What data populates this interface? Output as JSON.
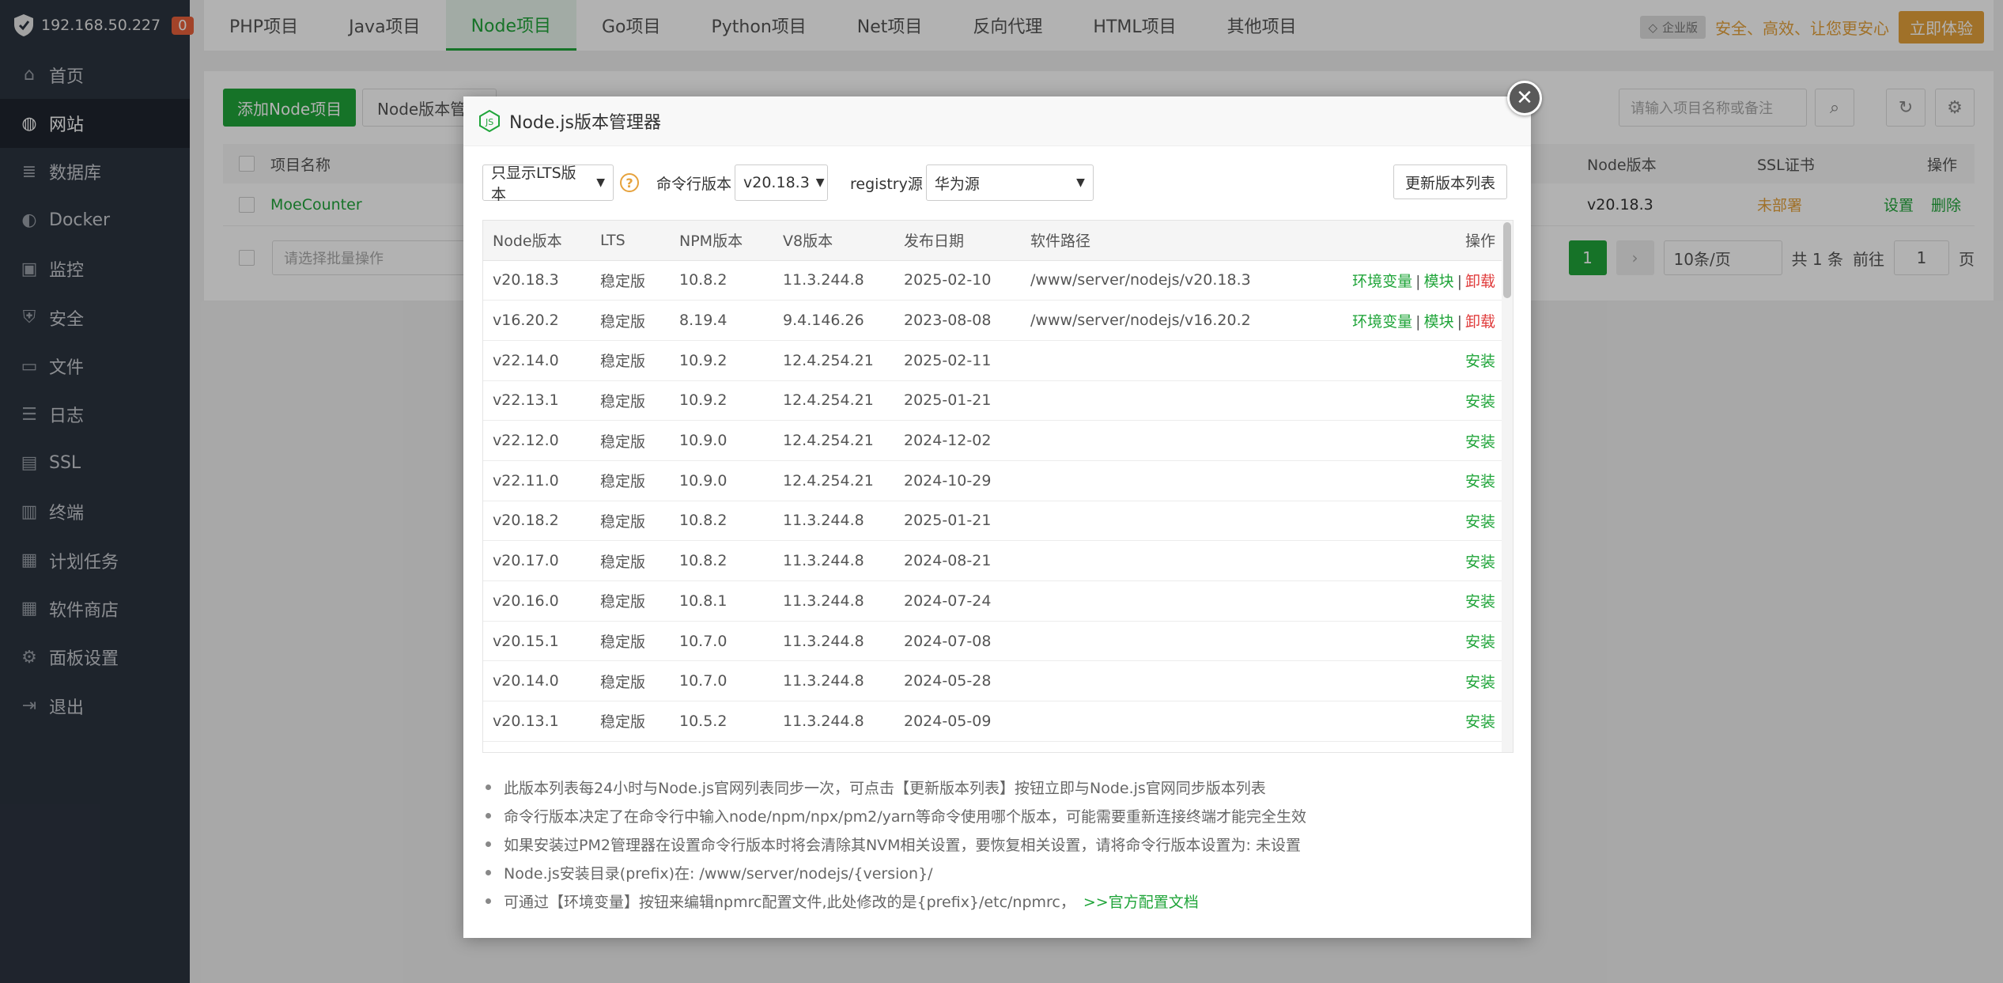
{
  "sidebar": {
    "host": "192.168.50.227",
    "badge": "0",
    "items": [
      {
        "label": "首页",
        "icon": "home-icon"
      },
      {
        "label": "网站",
        "icon": "globe-icon",
        "active": true
      },
      {
        "label": "数据库",
        "icon": "database-icon"
      },
      {
        "label": "Docker",
        "icon": "docker-icon"
      },
      {
        "label": "监控",
        "icon": "monitor-icon"
      },
      {
        "label": "安全",
        "icon": "shield-icon"
      },
      {
        "label": "文件",
        "icon": "folder-icon"
      },
      {
        "label": "日志",
        "icon": "log-icon"
      },
      {
        "label": "SSL",
        "icon": "ssl-icon"
      },
      {
        "label": "终端",
        "icon": "terminal-icon"
      },
      {
        "label": "计划任务",
        "icon": "calendar-icon"
      },
      {
        "label": "软件商店",
        "icon": "grid-icon"
      },
      {
        "label": "面板设置",
        "icon": "gear-icon"
      },
      {
        "label": "退出",
        "icon": "logout-icon"
      }
    ]
  },
  "topbar": {
    "tabs": [
      "PHP项目",
      "Java项目",
      "Node项目",
      "Go项目",
      "Python项目",
      "Net项目",
      "反向代理",
      "HTML项目",
      "其他项目"
    ],
    "active_tab": "Node项目",
    "enterprise_tag": "企业版",
    "slogan": "安全、高效、让您更安心",
    "try_button": "立即体验"
  },
  "page": {
    "add_button": "添加Node项目",
    "version_button": "Node版本管理",
    "search_placeholder": "请输入项目名称或备注",
    "table_headers": {
      "name": "项目名称",
      "node_version": "Node版本",
      "ssl": "SSL证书",
      "ops": "操作"
    },
    "row": {
      "name": "MoeCounter",
      "node_version": "v20.18.3",
      "ssl": "未部署",
      "settings": "设置",
      "delete": "删除"
    },
    "batch_placeholder": "请选择批量操作",
    "pagination": {
      "current": "1",
      "per_page": "10条/页",
      "total": "共 1 条",
      "goto": "前往",
      "page_input": "1",
      "page_suffix": "页"
    }
  },
  "modal": {
    "title": "Node.js版本管理器",
    "filter_select": "只显示LTS版本",
    "cmd_label": "命令行版本",
    "cmd_select": "v20.18.3",
    "registry_label": "registry源",
    "registry_select": "华为源",
    "refresh_button": "更新版本列表",
    "columns": [
      "Node版本",
      "LTS",
      "NPM版本",
      "V8版本",
      "发布日期",
      "软件路径",
      "操作"
    ],
    "rows": [
      {
        "version": "v20.18.3",
        "lts": "稳定版",
        "npm": "10.8.2",
        "v8": "11.3.244.8",
        "date": "2025-02-10",
        "path": "/www/server/nodejs/v20.18.3",
        "installed": true
      },
      {
        "version": "v16.20.2",
        "lts": "稳定版",
        "npm": "8.19.4",
        "v8": "9.4.146.26",
        "date": "2023-08-08",
        "path": "/www/server/nodejs/v16.20.2",
        "installed": true
      },
      {
        "version": "v22.14.0",
        "lts": "稳定版",
        "npm": "10.9.2",
        "v8": "12.4.254.21",
        "date": "2025-02-11",
        "path": "",
        "installed": false
      },
      {
        "version": "v22.13.1",
        "lts": "稳定版",
        "npm": "10.9.2",
        "v8": "12.4.254.21",
        "date": "2025-01-21",
        "path": "",
        "installed": false
      },
      {
        "version": "v22.12.0",
        "lts": "稳定版",
        "npm": "10.9.0",
        "v8": "12.4.254.21",
        "date": "2024-12-02",
        "path": "",
        "installed": false
      },
      {
        "version": "v22.11.0",
        "lts": "稳定版",
        "npm": "10.9.0",
        "v8": "12.4.254.21",
        "date": "2024-10-29",
        "path": "",
        "installed": false
      },
      {
        "version": "v20.18.2",
        "lts": "稳定版",
        "npm": "10.8.2",
        "v8": "11.3.244.8",
        "date": "2025-01-21",
        "path": "",
        "installed": false
      },
      {
        "version": "v20.17.0",
        "lts": "稳定版",
        "npm": "10.8.2",
        "v8": "11.3.244.8",
        "date": "2024-08-21",
        "path": "",
        "installed": false
      },
      {
        "version": "v20.16.0",
        "lts": "稳定版",
        "npm": "10.8.1",
        "v8": "11.3.244.8",
        "date": "2024-07-24",
        "path": "",
        "installed": false
      },
      {
        "version": "v20.15.1",
        "lts": "稳定版",
        "npm": "10.7.0",
        "v8": "11.3.244.8",
        "date": "2024-07-08",
        "path": "",
        "installed": false
      },
      {
        "version": "v20.14.0",
        "lts": "稳定版",
        "npm": "10.7.0",
        "v8": "11.3.244.8",
        "date": "2024-05-28",
        "path": "",
        "installed": false
      },
      {
        "version": "v20.13.1",
        "lts": "稳定版",
        "npm": "10.5.2",
        "v8": "11.3.244.8",
        "date": "2024-05-09",
        "path": "",
        "installed": false
      }
    ],
    "actions": {
      "env": "环境变量",
      "module": "模块",
      "uninstall": "卸载",
      "install": "安装"
    },
    "notes": [
      "此版本列表每24小时与Node.js官网列表同步一次，可点击【更新版本列表】按钮立即与Node.js官网同步版本列表",
      "命令行版本决定了在命令行中输入node/npm/npx/pm2/yarn等命令使用哪个版本，可能需要重新连接终端才能完全生效",
      "如果安装过PM2管理器在设置命令行版本时将会清除其NVM相关设置，要恢复相关设置，请将命令行版本设置为: 未设置",
      "Node.js安装目录(prefix)在: /www/server/nodejs/{version}/",
      "可通过【环境变量】按钮来编辑npmrc配置文件,此处修改的是{prefix}/etc/npmrc，"
    ],
    "doc_link": ">>官方配置文档"
  }
}
